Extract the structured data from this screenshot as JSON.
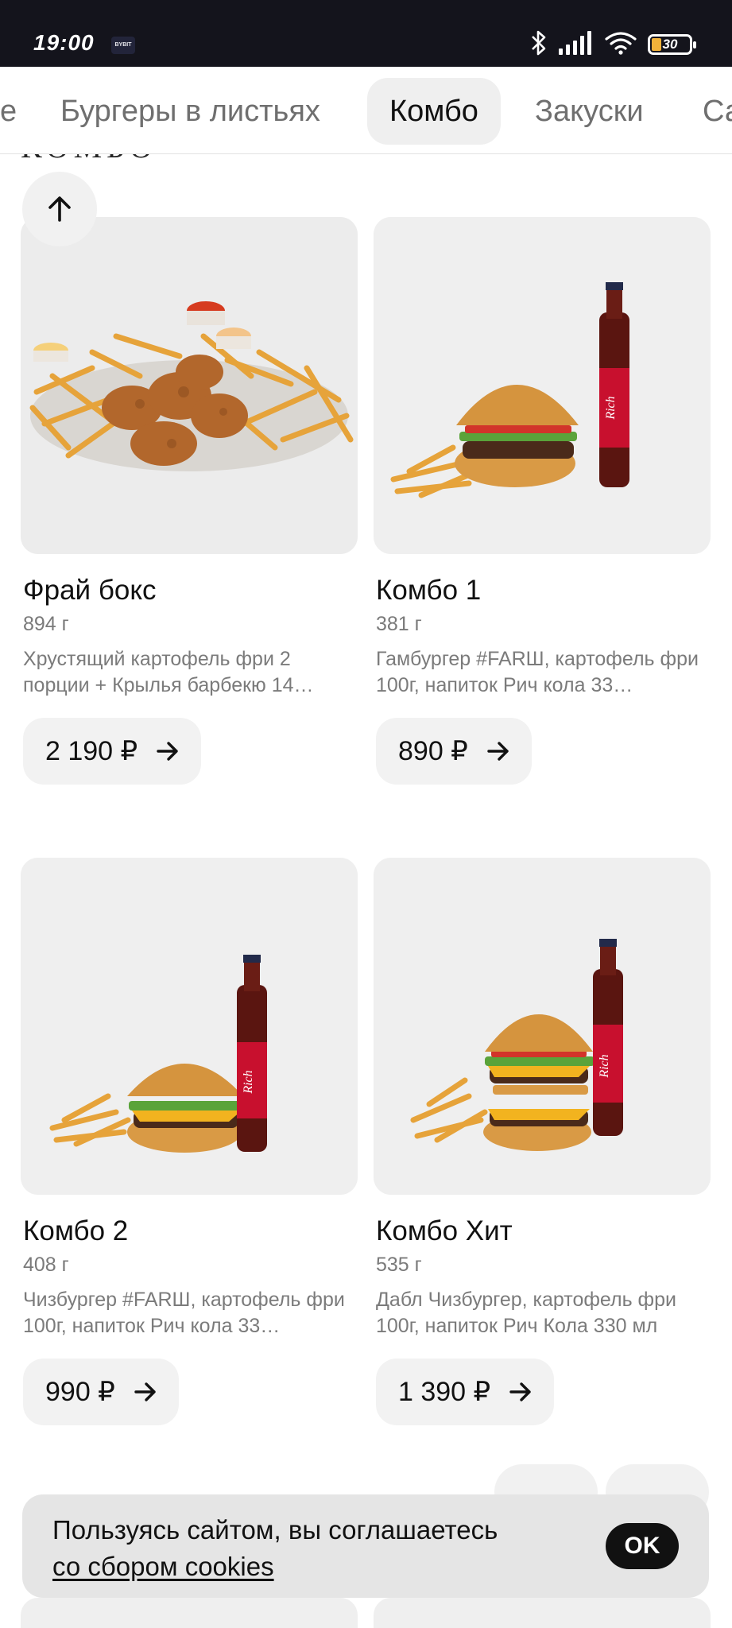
{
  "status_bar": {
    "time": "19:00",
    "app_badge": "BYBIT",
    "battery": "30"
  },
  "categories": {
    "items": [
      {
        "label": "е"
      },
      {
        "label": "Бургеры в листьях"
      },
      {
        "label": "Комбо",
        "active": true
      },
      {
        "label": "Закуски"
      },
      {
        "label": "Са"
      }
    ]
  },
  "section": {
    "title_partial": "КОМБО"
  },
  "products": [
    {
      "title": "Фрай бокс",
      "weight": "894 г",
      "description": "Хрустящий картофель фри 2 порции + Крылья барбекю 14…",
      "price": "2 190 ₽",
      "image": "fries-wings-illustration"
    },
    {
      "title": "Комбо 1",
      "weight": "381 г",
      "description": "Гамбургер #FARШ, картофель фри 100г, напиток Рич кола 33…",
      "price": "890 ₽",
      "image": "burger-fries-cola-illustration"
    },
    {
      "title": "Комбо 2",
      "weight": "408 г",
      "description": "Чизбургер #FARШ, картофель фри 100г, напиток Рич кола 33…",
      "price": "990 ₽",
      "image": "cheeseburger-fries-cola-illustration"
    },
    {
      "title": "Комбо Хит",
      "weight": "535 г",
      "description": "Дабл Чизбургер, картофель фри 100г, напиток Рич Кола 330 мл",
      "price": "1 390 ₽",
      "image": "double-cheeseburger-fries-cola-illustration"
    }
  ],
  "cookie_banner": {
    "text_line1": "Пользуясь сайтом, вы соглашаетесь",
    "link_text": "со сбором cookies",
    "ok_label": "OK"
  },
  "icons": {
    "scroll_up": "arrow-up-icon",
    "price_arrow": "arrow-right-icon",
    "bluetooth": "bluetooth-icon",
    "signal": "signal-icon",
    "wifi": "wifi-icon",
    "battery": "battery-icon"
  },
  "colors": {
    "status_bar_bg": "#14141c",
    "active_tab_bg": "#efefef",
    "price_button_bg": "#f2f2f2",
    "ok_button_bg": "#111111",
    "cola_label_red": "#c8102e"
  }
}
